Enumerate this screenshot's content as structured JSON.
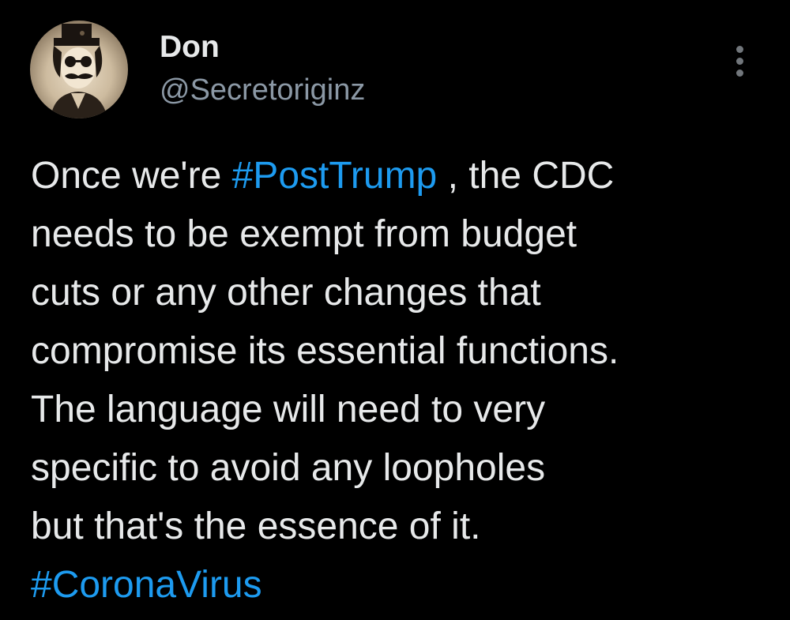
{
  "tweet": {
    "author": {
      "name": "Don",
      "handle": "@Secretoriginz"
    },
    "more_icon": "more-vertical-icon",
    "body": {
      "line1": {
        "before": "Once we're ",
        "hashtag": "#PostTrump",
        "after": " , the CDC"
      },
      "line2": "needs to be exempt from budget",
      "line3": "cuts or any other changes that",
      "line4": "compromise its essential functions.",
      "line5": "The language will need to very",
      "line6": "specific to avoid any loopholes",
      "line7": "but that's the essence of it.",
      "hashtag2": "#CoronaVirus"
    },
    "colors": {
      "background": "#000000",
      "text": "#e7e9ea",
      "secondary_text": "#8b98a5",
      "link": "#1d9bf0"
    }
  }
}
